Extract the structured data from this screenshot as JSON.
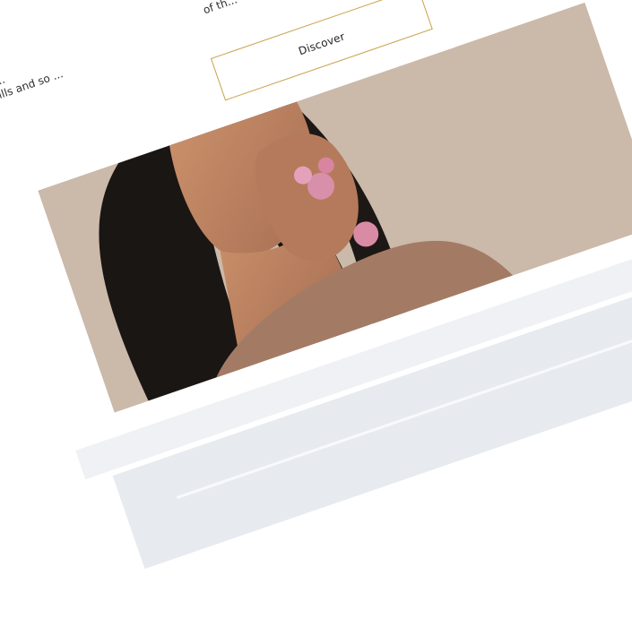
{
  "intro": {
    "left_line_1": "co...",
    "left_line_2": "skills and so ...",
    "right_line_1": "of th..."
  },
  "cta": {
    "label": "Discover"
  },
  "hero_image": {
    "alt": "Woman wearing pink floral rings"
  }
}
